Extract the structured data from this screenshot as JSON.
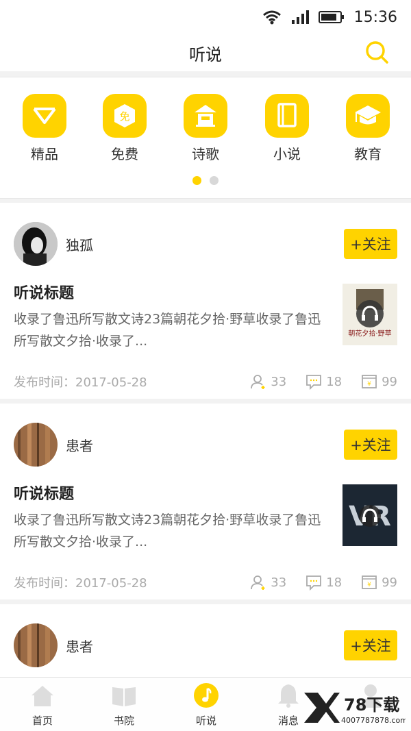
{
  "status": {
    "time": "15:36"
  },
  "header": {
    "title": "听说"
  },
  "categories": [
    {
      "label": "精品",
      "icon": "diamond-icon"
    },
    {
      "label": "免费",
      "icon": "free-badge-icon",
      "badge": "免"
    },
    {
      "label": "诗歌",
      "icon": "pavilion-icon"
    },
    {
      "label": "小说",
      "icon": "book-icon"
    },
    {
      "label": "教育",
      "icon": "graduation-cap-icon"
    }
  ],
  "posts": [
    {
      "user": "独孤",
      "follow": "+关注",
      "title": "听说标题",
      "desc": "收录了鲁迅所写散文诗23篇朝花夕拾·野草收录了鲁迅所写散文夕拾·收录了...",
      "date": "发布时间：2017-05-28",
      "likes": "33",
      "comments": "18",
      "coins": "99",
      "thumb_text": "朝花夕拾·野草"
    },
    {
      "user": "患者",
      "follow": "+关注",
      "title": "听说标题",
      "desc": "收录了鲁迅所写散文诗23篇朝花夕拾·野草收录了鲁迅所写散文夕拾·收录了...",
      "date": "发布时间：2017-05-28",
      "likes": "33",
      "comments": "18",
      "coins": "99",
      "thumb_text": "VR"
    },
    {
      "user": "患者",
      "follow": "+关注"
    }
  ],
  "tabs": [
    {
      "label": "首页",
      "icon": "home-icon"
    },
    {
      "label": "书院",
      "icon": "book-open-icon"
    },
    {
      "label": "听说",
      "icon": "music-note-icon",
      "active": true
    },
    {
      "label": "消息",
      "icon": "bell-icon"
    },
    {
      "label": "",
      "icon": "user-icon"
    }
  ],
  "watermark": {
    "brand": "78下载",
    "site": "4007787878.com"
  },
  "colors": {
    "accent": "#ffd300"
  }
}
